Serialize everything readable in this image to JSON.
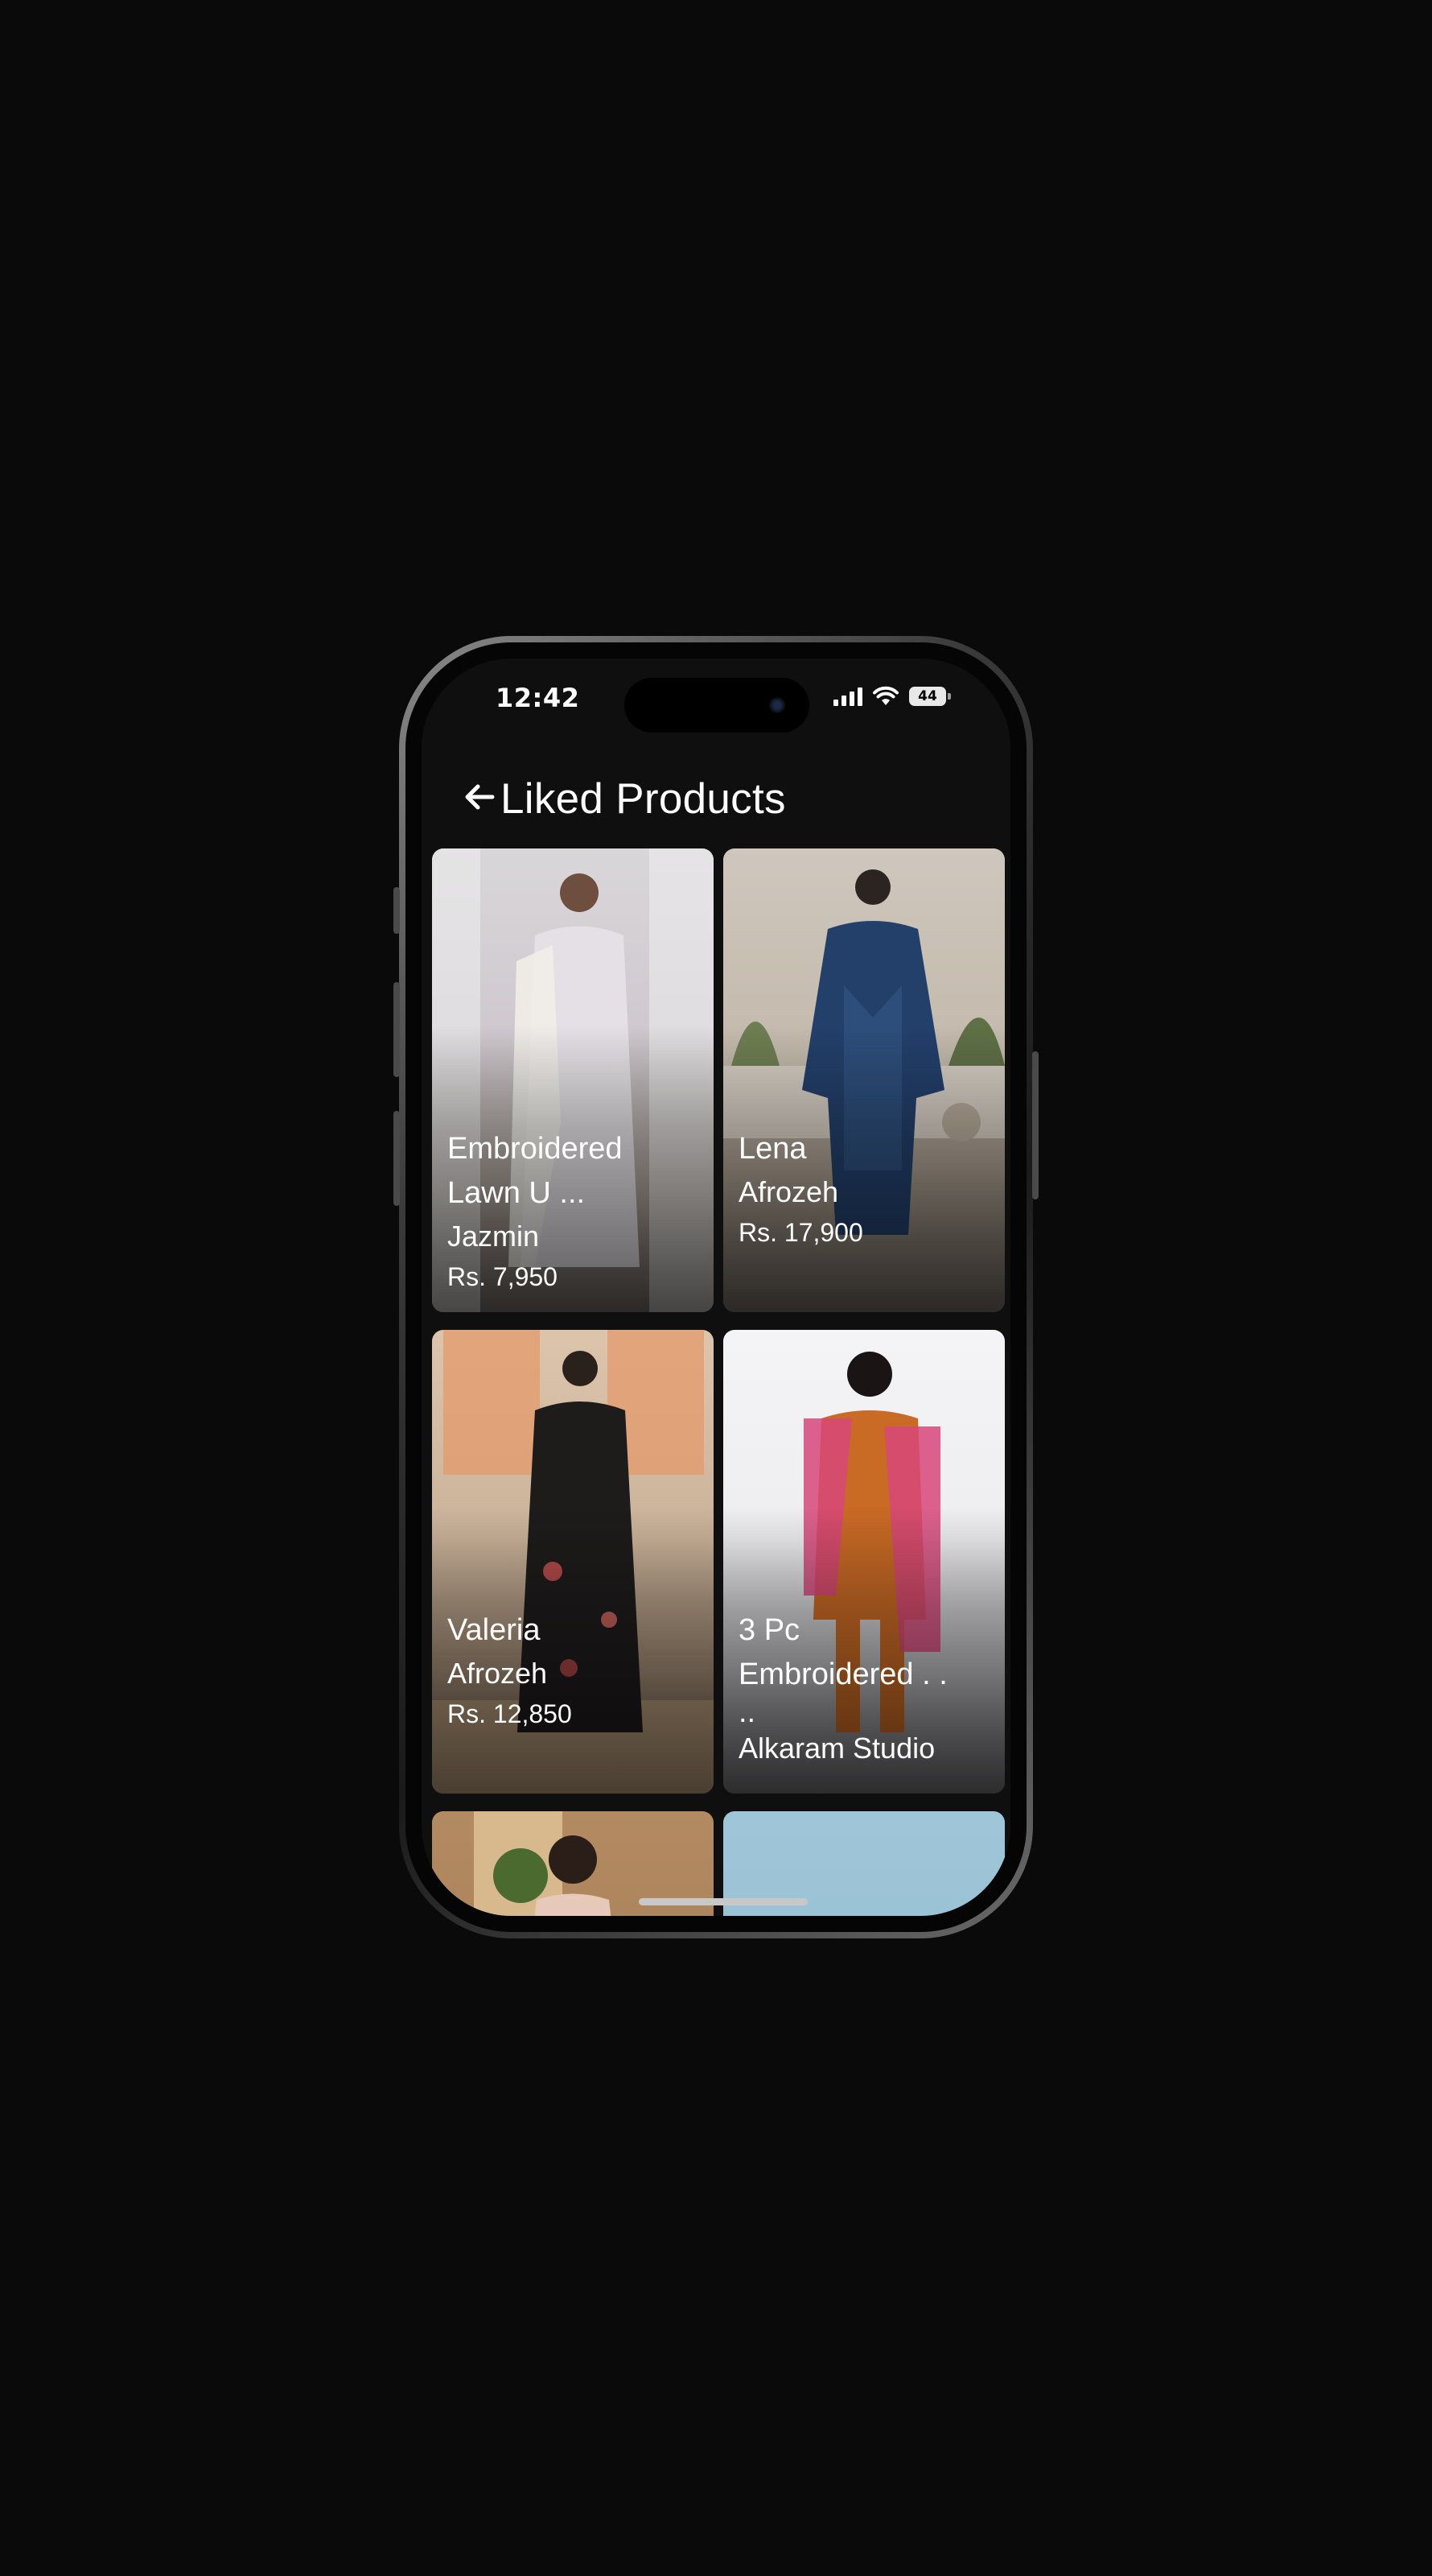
{
  "status_bar": {
    "time": "12:42",
    "battery": "44",
    "icons": [
      "signal-icon",
      "wifi-icon",
      "battery-icon"
    ]
  },
  "header": {
    "title": "Liked Products",
    "back_icon": "arrow-left-icon"
  },
  "products": [
    {
      "name_line1": "Embroidered",
      "name_line2": "Lawn U ...",
      "brand": "Jazmin",
      "price": "Rs. 7,950"
    },
    {
      "name_line1": "Lena",
      "brand": "Afrozeh",
      "price": "Rs. 17,900"
    },
    {
      "name_line1": "Valeria",
      "brand": "Afrozeh",
      "price": "Rs. 12,850"
    },
    {
      "name_line1": "3 Pc",
      "name_line2": "Embroidered . .",
      "name_line3": "..",
      "brand": "Alkaram Studio"
    },
    {},
    {}
  ],
  "colors": {
    "background": "#0a0a0a",
    "screen": "#0f0f0f",
    "text": "#ffffff"
  }
}
